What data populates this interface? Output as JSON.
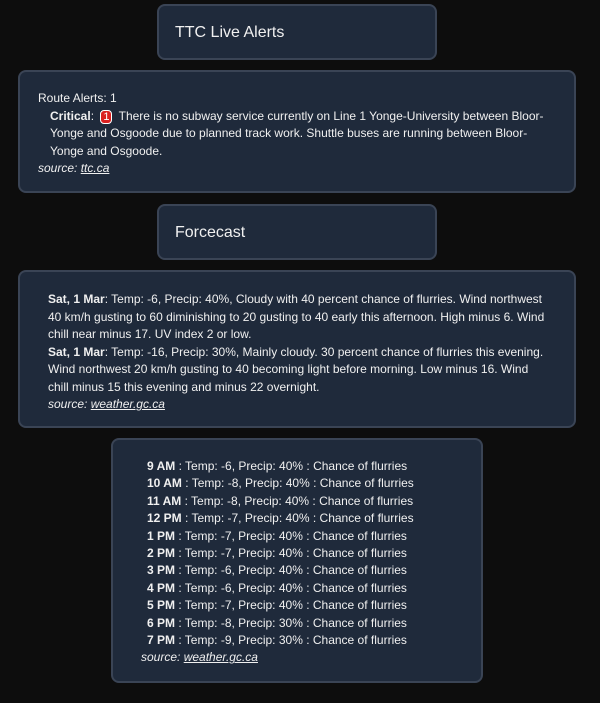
{
  "alerts": {
    "title": "TTC Live Alerts",
    "count_label": "Route Alerts: 1",
    "items": [
      {
        "severity": "Critical",
        "badge": "1",
        "text": "There is no subway service currently on Line 1 Yonge-University between Bloor-Yonge and Osgoode due to planned track work. Shuttle buses are running between Bloor-Yonge and Osgoode."
      }
    ],
    "source_label": "source:",
    "source_link": "ttc.ca"
  },
  "forecast": {
    "title": "Forcecast",
    "items": [
      {
        "day": "Sat, 1 Mar",
        "text": ": Temp: -6, Precip: 40%, Cloudy with 40 percent chance of flurries. Wind northwest 40 km/h gusting to 60 diminishing to 20 gusting to 40 early this afternoon. High minus 6. Wind chill near minus 17. UV index 2 or low."
      },
      {
        "day": "Sat, 1 Mar",
        "text": ": Temp: -16, Precip: 30%, Mainly cloudy. 30 percent chance of flurries this evening. Wind northwest 20 km/h gusting to 40 becoming light before morning. Low minus 16. Wind chill minus 15 this evening and minus 22 overnight."
      }
    ],
    "source_label": "source:",
    "source_link": "weather.gc.ca"
  },
  "hourly": {
    "items": [
      {
        "time": "9 AM",
        "text": " : Temp: -6, Precip: 40% : Chance of flurries"
      },
      {
        "time": "10 AM",
        "text": " : Temp: -8, Precip: 40% : Chance of flurries"
      },
      {
        "time": "11 AM",
        "text": " : Temp: -8, Precip: 40% : Chance of flurries"
      },
      {
        "time": "12 PM",
        "text": " : Temp: -7, Precip: 40% : Chance of flurries"
      },
      {
        "time": "1 PM",
        "text": " : Temp: -7, Precip: 40% : Chance of flurries"
      },
      {
        "time": "2 PM",
        "text": " : Temp: -7, Precip: 40% : Chance of flurries"
      },
      {
        "time": "3 PM",
        "text": " : Temp: -6, Precip: 40% : Chance of flurries"
      },
      {
        "time": "4 PM",
        "text": " : Temp: -6, Precip: 40% : Chance of flurries"
      },
      {
        "time": "5 PM",
        "text": " : Temp: -7, Precip: 40% : Chance of flurries"
      },
      {
        "time": "6 PM",
        "text": " : Temp: -8, Precip: 30% : Chance of flurries"
      },
      {
        "time": "7 PM",
        "text": " : Temp: -9, Precip: 30% : Chance of flurries"
      }
    ],
    "source_label": "source:",
    "source_link": "weather.gc.ca"
  },
  "colors": {
    "background": "#0d0d0d",
    "panel": "#1f2a3b",
    "critical_badge": "#d92020"
  }
}
